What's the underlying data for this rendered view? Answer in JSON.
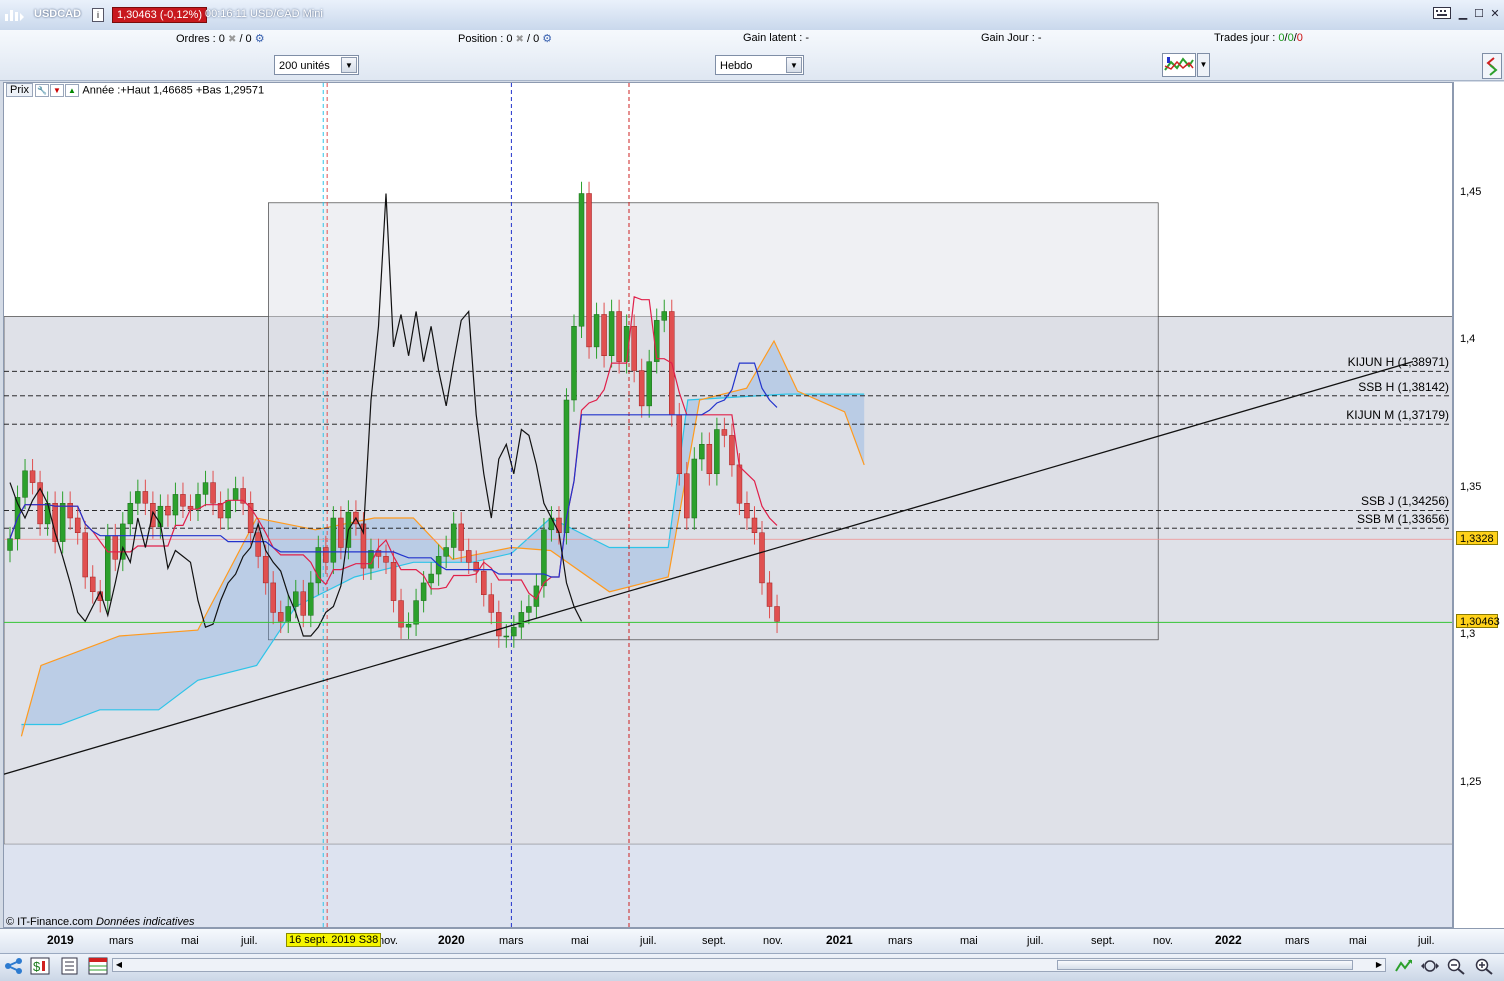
{
  "window": {
    "symbol": "USDCAD",
    "price_badge": "1,30463 (-0,12%)",
    "clock_title": "00:16:11  USD/CAD Mini"
  },
  "toolbar": {
    "orders_label": "Ordres :",
    "orders_value": "0",
    "orders_value2": "/ 0",
    "position_label": "Position :",
    "position_value": "0",
    "position_value2": "/ 0",
    "gain_latent": "Gain latent :  -",
    "gain_jour": "Gain Jour :  -",
    "trades_label": "Trades jour :",
    "trades_v1": "0",
    "trades_sep1": "/",
    "trades_v2": "0",
    "trades_sep2": "/",
    "trades_v3": "0",
    "units_select": "200 unités",
    "period_select": "Hebdo"
  },
  "legend": {
    "prix": "Prix",
    "text": "Année :+Haut 1,46685 +Bas 1,29571"
  },
  "price_axis": {
    "ticks": [
      "1,45",
      "1,4",
      "1,35",
      "1,3",
      "1,25"
    ],
    "crosshair_price": "1,3328",
    "last_price": "1,30463"
  },
  "levels": [
    {
      "label": "KIJUN H (1,38971)",
      "value": 1.38971
    },
    {
      "label": "SSB H (1,38142)",
      "value": 1.38142
    },
    {
      "label": "KIJUN M (1,37179)",
      "value": 1.37179
    },
    {
      "label": "SSB J (1,34256)",
      "value": 1.34256
    },
    {
      "label": "SSB M (1,33656)",
      "value": 1.33656
    }
  ],
  "time_axis": {
    "labels": [
      {
        "text": "2019",
        "year": true
      },
      {
        "text": "mars"
      },
      {
        "text": "mai"
      },
      {
        "text": "juil."
      },
      {
        "text": "nov."
      },
      {
        "text": "2020",
        "year": true
      },
      {
        "text": "mars"
      },
      {
        "text": "mai"
      },
      {
        "text": "juil."
      },
      {
        "text": "sept."
      },
      {
        "text": "nov."
      },
      {
        "text": "2021",
        "year": true
      },
      {
        "text": "mars"
      },
      {
        "text": "mai"
      },
      {
        "text": "juil."
      },
      {
        "text": "sept."
      },
      {
        "text": "nov."
      },
      {
        "text": "2022",
        "year": true
      },
      {
        "text": "mars"
      },
      {
        "text": "mai"
      },
      {
        "text": "juil."
      }
    ],
    "cursor_date": "16 sept. 2019 S38"
  },
  "copyright": {
    "source": "© IT-Finance.com",
    "note": "Données indicatives"
  },
  "colors": {
    "up_candle": "#2ca02c",
    "down_candle": "#e05050",
    "kijun": "#2233cc",
    "tenkan": "#e0204a",
    "lagging": "#111111",
    "ssb": "#ff9a1e",
    "ssa": "#2ec4e8",
    "last_price_line": "#35c435",
    "price_label_bg": "#ffd21a"
  },
  "chart_data": {
    "type": "candlestick",
    "timeframe": "Hebdo",
    "ylim": [
      1.22,
      1.48
    ],
    "yticks": [
      1.25,
      1.3,
      1.35,
      1.4,
      1.45
    ],
    "last_price": 1.30463,
    "trend_line": [
      [
        2018.85,
        1.251
      ],
      [
        2022.5,
        1.393
      ]
    ],
    "year_box": {
      "from": 2019.58,
      "to": 2021.85,
      "high": 1.44685,
      "low": 1.29871
    },
    "range_band": {
      "high": 1.40829,
      "low": 1.22941
    },
    "vlines": [
      {
        "date": 2019.72,
        "color": "#2ec4e8"
      },
      {
        "date": 2019.73,
        "color": "#e05050"
      },
      {
        "date": 2020.2,
        "color": "#2233cc"
      },
      {
        "date": 2020.5,
        "color": "#cc2020"
      }
    ],
    "closes": [
      1.333,
      1.347,
      1.356,
      1.352,
      1.338,
      1.345,
      1.332,
      1.345,
      1.34,
      1.335,
      1.32,
      1.315,
      1.312,
      1.334,
      1.326,
      1.338,
      1.345,
      1.349,
      1.345,
      1.337,
      1.344,
      1.341,
      1.348,
      1.344,
      1.343,
      1.348,
      1.352,
      1.345,
      1.34,
      1.346,
      1.35,
      1.345,
      1.335,
      1.327,
      1.318,
      1.308,
      1.305,
      1.31,
      1.315,
      1.307,
      1.318,
      1.33,
      1.325,
      1.34,
      1.33,
      1.342,
      1.338,
      1.323,
      1.329,
      1.327,
      1.325,
      1.312,
      1.303,
      1.304,
      1.312,
      1.318,
      1.321,
      1.327,
      1.33,
      1.338,
      1.329,
      1.325,
      1.322,
      1.314,
      1.308,
      1.3,
      1.3,
      1.303,
      1.308,
      1.31,
      1.317,
      1.336,
      1.34,
      1.335,
      1.38,
      1.405,
      1.45,
      1.398,
      1.409,
      1.395,
      1.41,
      1.393,
      1.405,
      1.39,
      1.378,
      1.393,
      1.407,
      1.41,
      1.375,
      1.355,
      1.34,
      1.36,
      1.365,
      1.355,
      1.37,
      1.368,
      1.358,
      1.345,
      1.34,
      1.335,
      1.318,
      1.31,
      1.305
    ],
    "first_date": 2019.0,
    "step_weeks": 1
  }
}
